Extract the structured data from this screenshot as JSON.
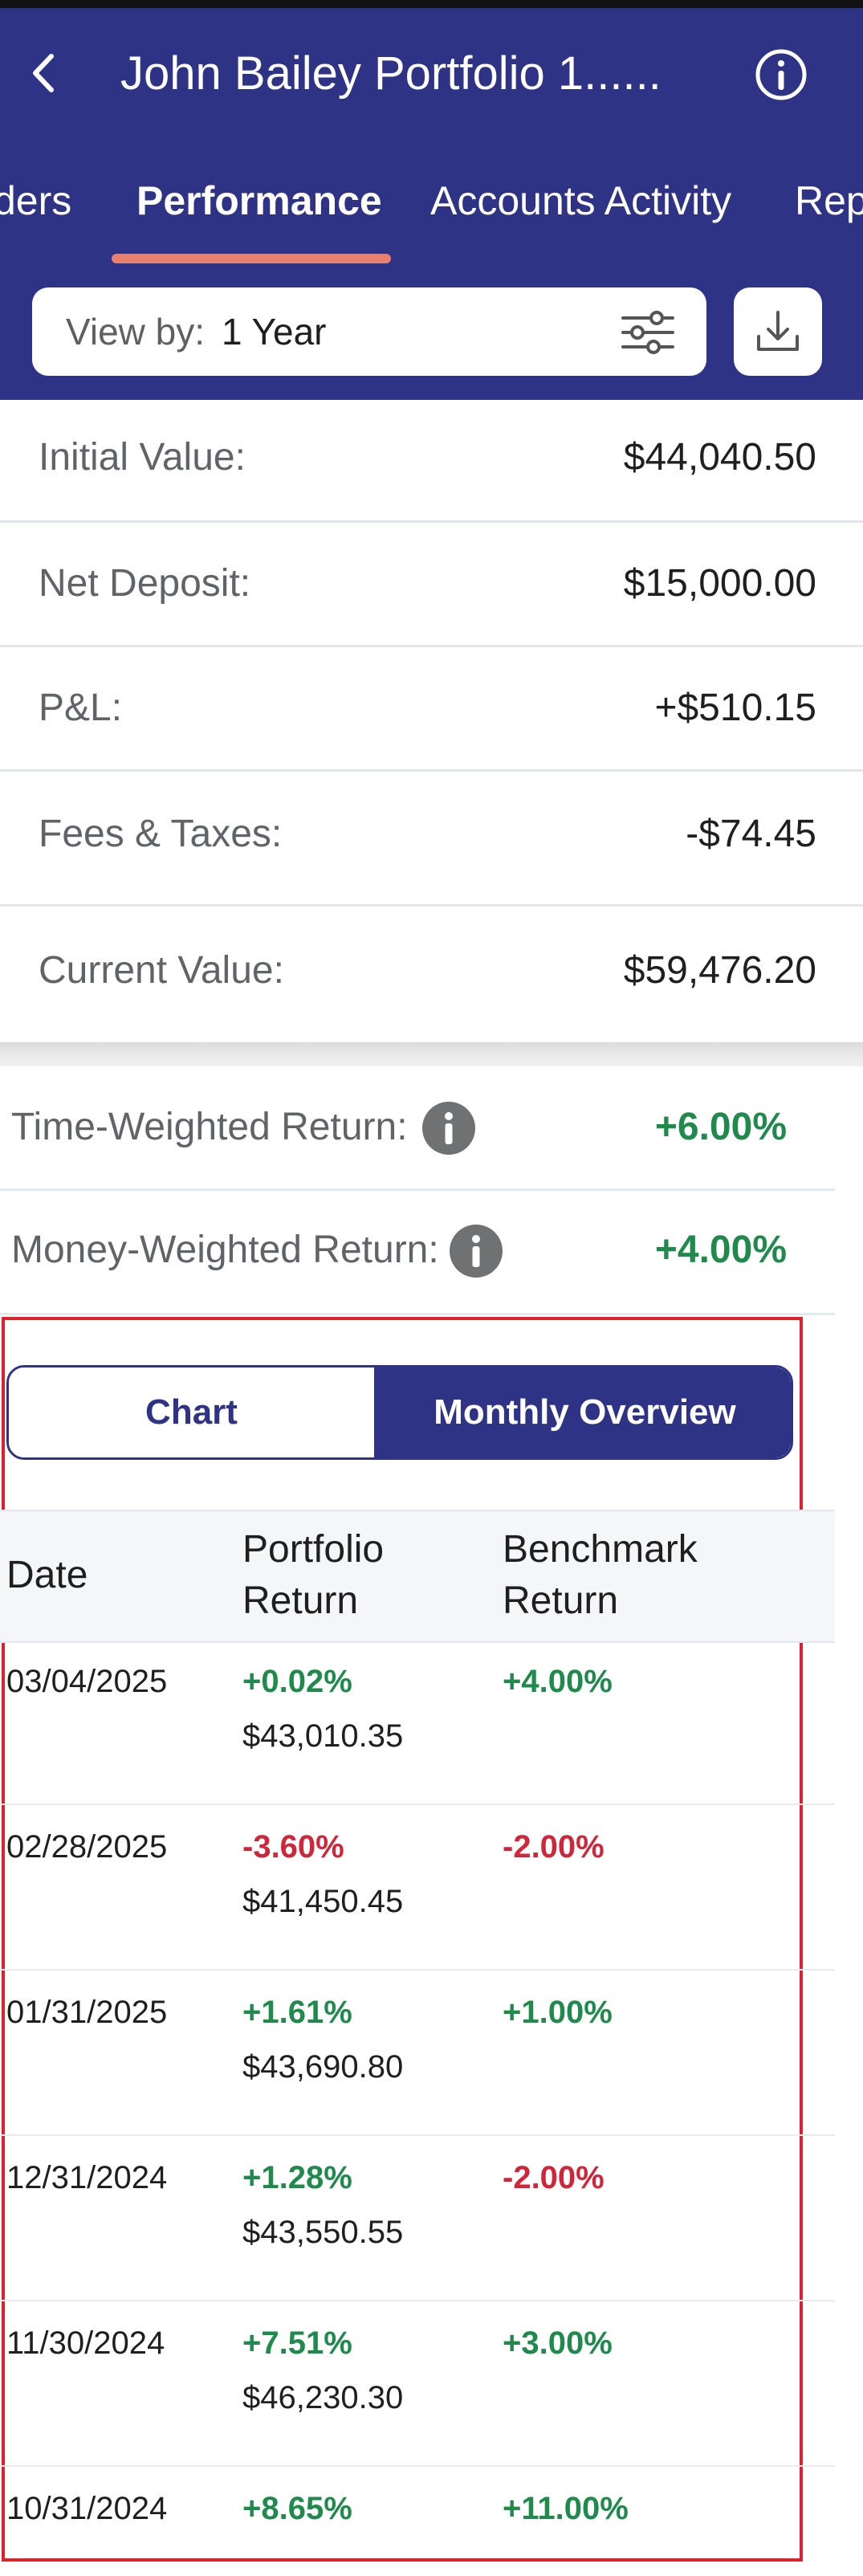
{
  "header": {
    "title": "John Bailey Portfolio 1......",
    "tabs": [
      {
        "label": "ders"
      },
      {
        "label": "Performance"
      },
      {
        "label": "Accounts Activity"
      },
      {
        "label": "Rep"
      }
    ],
    "view_by": {
      "label": "View by:",
      "value": "1 Year"
    }
  },
  "summary": [
    {
      "label": "Initial Value:",
      "value": "$44,040.50"
    },
    {
      "label": "Net Deposit:",
      "value": "$15,000.00"
    },
    {
      "label": "P&L:",
      "value": "+$510.15"
    },
    {
      "label": "Fees & Taxes:",
      "value": "-$74.45"
    },
    {
      "label": "Current Value:",
      "value": "$59,476.20"
    }
  ],
  "returns": [
    {
      "label": "Time-Weighted Return:",
      "value": "+6.00%"
    },
    {
      "label": "Money-Weighted Return:",
      "value": "+4.00%"
    }
  ],
  "segment": {
    "chart": "Chart",
    "monthly": "Monthly Overview"
  },
  "table": {
    "headers": {
      "date": "Date",
      "portfolio_1": "Portfolio",
      "portfolio_2": "Return",
      "benchmark_1": "Benchmark",
      "benchmark_2": "Return"
    },
    "rows": [
      {
        "date": "03/04/2025",
        "portfolio_return": "+0.02%",
        "portfolio_value": "$43,010.35",
        "benchmark_return": "+4.00%"
      },
      {
        "date": "02/28/2025",
        "portfolio_return": "-3.60%",
        "portfolio_value": "$41,450.45",
        "benchmark_return": "-2.00%"
      },
      {
        "date": "01/31/2025",
        "portfolio_return": "+1.61%",
        "portfolio_value": "$43,690.80",
        "benchmark_return": "+1.00%"
      },
      {
        "date": "12/31/2024",
        "portfolio_return": "+1.28%",
        "portfolio_value": "$43,550.55",
        "benchmark_return": "-2.00%"
      },
      {
        "date": "11/30/2024",
        "portfolio_return": "+7.51%",
        "portfolio_value": "$46,230.30",
        "benchmark_return": "+3.00%"
      },
      {
        "date": "10/31/2024",
        "portfolio_return": "+8.65%",
        "portfolio_value": "",
        "benchmark_return": "+11.00%"
      }
    ]
  },
  "colors": {
    "header_bg": "#2f3386",
    "tab_indicator": "#e9806f",
    "positive": "#1f8a4c",
    "negative": "#d0263a",
    "highlight_border": "#e0202c"
  },
  "icons": {
    "back": "chevron-left-icon",
    "info": "info-icon",
    "filter": "sliders-icon",
    "download": "download-icon"
  }
}
